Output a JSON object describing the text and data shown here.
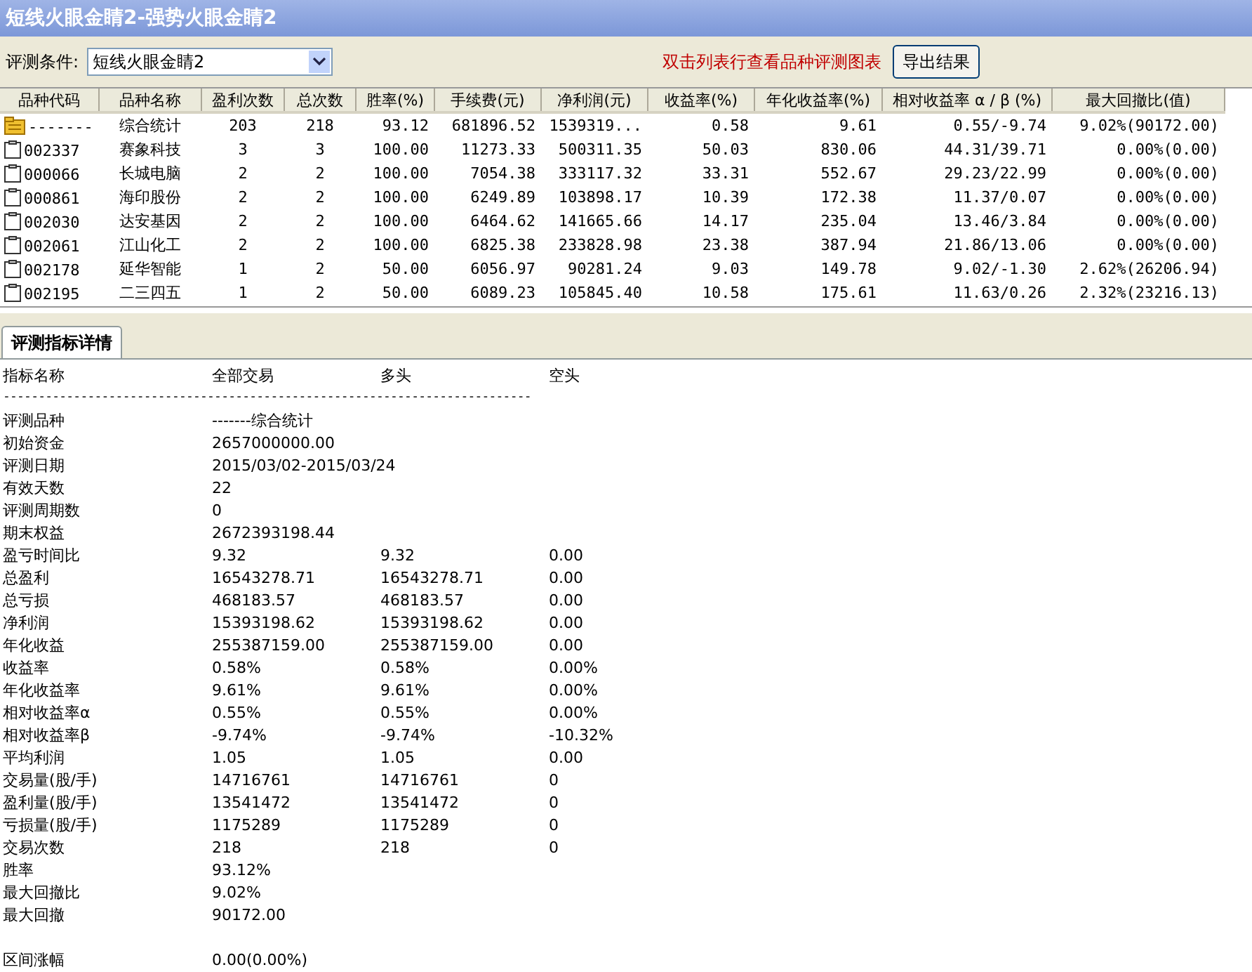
{
  "window": {
    "title": "短线火眼金睛2-强势火眼金睛2"
  },
  "toolbar": {
    "condition_label": "评测条件:",
    "condition_value": "短线火眼金睛2",
    "hint": "双击列表行查看品种评测图表",
    "buttons": [
      "导出结果"
    ]
  },
  "table": {
    "columns": [
      "品种代码",
      "品种名称",
      "盈利次数",
      "总次数",
      "胜率(%)",
      "手续费(元)",
      "净利润(元)",
      "收益率(%)",
      "年化收益率(%)",
      "相对收益率 α / β (%)",
      "最大回撤比(值)"
    ],
    "rows": [
      {
        "kind": "summary",
        "cells": [
          "-------",
          "综合统计",
          "203",
          "218",
          "93.12",
          "681896.52",
          "1539319...",
          "0.58",
          "9.61",
          "0.55/-9.74",
          "9.02%(90172.00)"
        ]
      },
      {
        "kind": "stock",
        "cells": [
          "002337",
          "赛象科技",
          "3",
          "3",
          "100.00",
          "11273.33",
          "500311.35",
          "50.03",
          "830.06",
          "44.31/39.71",
          "0.00%(0.00)"
        ]
      },
      {
        "kind": "stock",
        "cells": [
          "000066",
          "长城电脑",
          "2",
          "2",
          "100.00",
          "7054.38",
          "333117.32",
          "33.31",
          "552.67",
          "29.23/22.99",
          "0.00%(0.00)"
        ]
      },
      {
        "kind": "stock",
        "cells": [
          "000861",
          "海印股份",
          "2",
          "2",
          "100.00",
          "6249.89",
          "103898.17",
          "10.39",
          "172.38",
          "11.37/0.07",
          "0.00%(0.00)"
        ]
      },
      {
        "kind": "stock",
        "cells": [
          "002030",
          "达安基因",
          "2",
          "2",
          "100.00",
          "6464.62",
          "141665.66",
          "14.17",
          "235.04",
          "13.46/3.84",
          "0.00%(0.00)"
        ]
      },
      {
        "kind": "stock",
        "cells": [
          "002061",
          "江山化工",
          "2",
          "2",
          "100.00",
          "6825.38",
          "233828.98",
          "23.38",
          "387.94",
          "21.86/13.06",
          "0.00%(0.00)"
        ]
      },
      {
        "kind": "stock",
        "cells": [
          "002178",
          "延华智能",
          "1",
          "2",
          "50.00",
          "6056.97",
          "90281.24",
          "9.03",
          "149.78",
          "9.02/-1.30",
          "2.62%(26206.94)"
        ]
      },
      {
        "kind": "stock",
        "cells": [
          "002195",
          "二三四五",
          "1",
          "2",
          "50.00",
          "6089.23",
          "105845.40",
          "10.58",
          "175.61",
          "11.63/0.26",
          "2.32%(23216.13)"
        ]
      }
    ]
  },
  "tabs": [
    {
      "label": "评测指标详情",
      "selected": true
    }
  ],
  "details": {
    "header": [
      "指标名称",
      "全部交易",
      "多头",
      "空头"
    ],
    "rows": [
      {
        "kind": "rule",
        "cells": [
          "---------------------------------------------------------------------------"
        ]
      },
      {
        "kind": "line",
        "cells": [
          "评测品种",
          "-------综合统计"
        ]
      },
      {
        "kind": "line",
        "cells": [
          "初始资金",
          "2657000000.00"
        ]
      },
      {
        "kind": "line",
        "cells": [
          "评测日期",
          "2015/03/02-2015/03/24"
        ]
      },
      {
        "kind": "line",
        "cells": [
          "有效天数",
          "22"
        ]
      },
      {
        "kind": "line",
        "cells": [
          "评测周期数",
          "0"
        ]
      },
      {
        "kind": "line",
        "cells": [
          "期末权益",
          "2672393198.44"
        ]
      },
      {
        "kind": "line",
        "cells": [
          "盈亏时间比",
          "9.32",
          "9.32",
          "0.00"
        ]
      },
      {
        "kind": "line",
        "cells": [
          "总盈利",
          "16543278.71",
          "16543278.71",
          "0.00"
        ]
      },
      {
        "kind": "line",
        "cells": [
          "总亏损",
          "468183.57",
          "468183.57",
          "0.00"
        ]
      },
      {
        "kind": "line",
        "cells": [
          "净利润",
          "15393198.62",
          "15393198.62",
          "0.00"
        ]
      },
      {
        "kind": "line",
        "cells": [
          "年化收益",
          "255387159.00",
          "255387159.00",
          "0.00"
        ]
      },
      {
        "kind": "line",
        "cells": [
          "收益率",
          "0.58%",
          "0.58%",
          "0.00%"
        ]
      },
      {
        "kind": "line",
        "cells": [
          "年化收益率",
          "9.61%",
          "9.61%",
          "0.00%"
        ]
      },
      {
        "kind": "line",
        "cells": [
          "相对收益率α",
          "0.55%",
          " 0.55%",
          " 0.00%"
        ]
      },
      {
        "kind": "line",
        "cells": [
          "相对收益率β",
          "-9.74%",
          " -9.74%",
          " -10.32%"
        ]
      },
      {
        "kind": "line",
        "cells": [
          "平均利润",
          "1.05",
          "1.05",
          "0.00"
        ]
      },
      {
        "kind": "line",
        "cells": [
          "交易量(股/手)",
          "14716761",
          "14716761",
          "0"
        ]
      },
      {
        "kind": "line",
        "cells": [
          "盈利量(股/手)",
          "13541472",
          "13541472",
          "0"
        ]
      },
      {
        "kind": "line",
        "cells": [
          "亏损量(股/手)",
          "1175289",
          "1175289",
          "0"
        ]
      },
      {
        "kind": "line",
        "cells": [
          "交易次数",
          "218",
          "218",
          "0"
        ]
      },
      {
        "kind": "line",
        "cells": [
          "胜率",
          "93.12%"
        ]
      },
      {
        "kind": "line",
        "cells": [
          "最大回撤比",
          "9.02%"
        ]
      },
      {
        "kind": "line",
        "cells": [
          "最大回撤",
          "90172.00"
        ]
      },
      {
        "kind": "blank",
        "cells": []
      },
      {
        "kind": "line",
        "cells": [
          "区间涨幅",
          "0.00(0.00%)"
        ]
      }
    ]
  }
}
